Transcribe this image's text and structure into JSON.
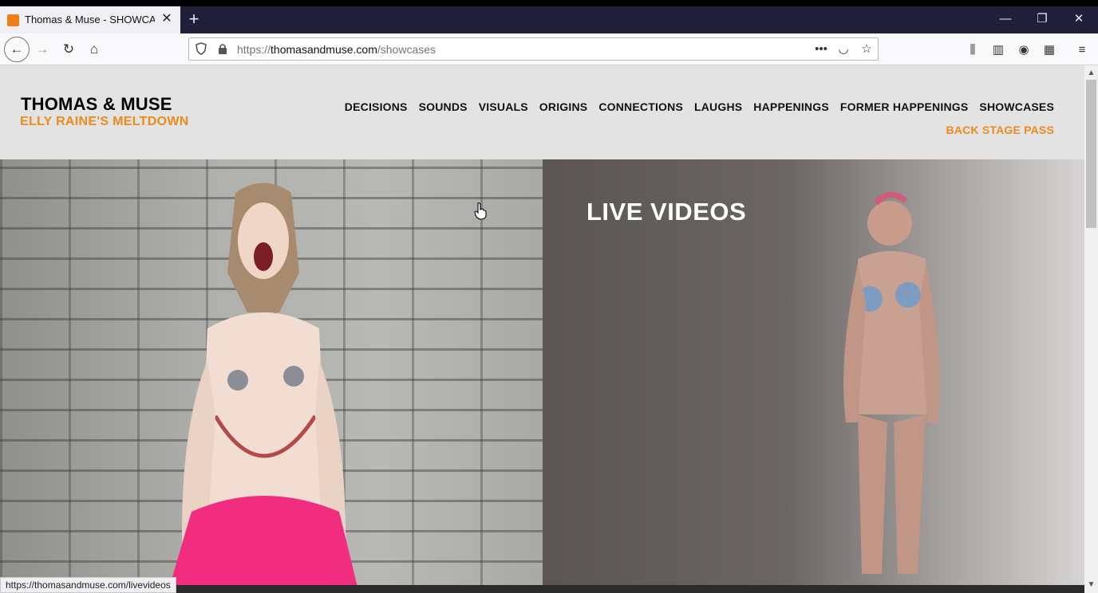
{
  "browser": {
    "tab": {
      "title": "Thomas & Muse - SHOWCASES",
      "close": "✕"
    },
    "new_tab": "+",
    "window": {
      "minimize": "—",
      "maximize": "❐",
      "close": "✕"
    },
    "nav": {
      "back": "←",
      "forward": "→",
      "reload": "↻",
      "home": "⌂"
    },
    "url": {
      "protocol": "https://",
      "host": "thomasandmuse.com",
      "path": "/showcases"
    },
    "url_actions": {
      "more": "•••",
      "pocket": "◡",
      "bookmark": "☆"
    },
    "toolbar_icons": {
      "library": "⫼",
      "sidebar": "▥",
      "account": "◉",
      "extension": "▦",
      "menu": "≡"
    },
    "status_url": "https://thomasandmuse.com/livevideos"
  },
  "site": {
    "brand": "THOMAS & MUSE",
    "tagline": "ELLY RAINE'S MELTDOWN",
    "menu": [
      {
        "label": "DECISIONS"
      },
      {
        "label": "SOUNDS"
      },
      {
        "label": "VISUALS"
      },
      {
        "label": "ORIGINS"
      },
      {
        "label": "CONNECTIONS"
      },
      {
        "label": "LAUGHS"
      },
      {
        "label": "HAPPENINGS"
      },
      {
        "label": "FORMER HAPPENINGS"
      },
      {
        "label": "SHOWCASES"
      }
    ],
    "menu_secondary": "BACK STAGE PASS",
    "panels": {
      "right_title": "LIVE VIDEOS"
    }
  },
  "colors": {
    "accent": "#ec8a1c",
    "header_bg": "#e3e3e3"
  },
  "scrollbar": {
    "up": "▲",
    "down": "▼"
  }
}
